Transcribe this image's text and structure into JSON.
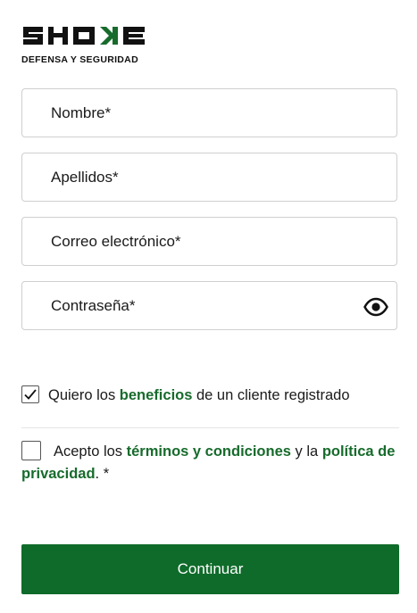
{
  "brand": {
    "logo_text": "SHOKE",
    "tagline": "DEFENSA Y SEGURIDAD",
    "logo_color": "#111111",
    "accent_color": "#176b2c"
  },
  "form": {
    "fields": [
      {
        "name": "nombre",
        "placeholder": "Nombre*",
        "value": ""
      },
      {
        "name": "apellidos",
        "placeholder": "Apellidos*",
        "value": ""
      },
      {
        "name": "correo",
        "placeholder": "Correo electrónico*",
        "value": ""
      },
      {
        "name": "contrasena",
        "placeholder": "Contraseña*",
        "value": "",
        "icon": "eye-icon"
      }
    ],
    "benefits": {
      "checked": true,
      "text_before": "Quiero los",
      "link": "beneficios",
      "text_after": "de un cliente registrado"
    },
    "terms": {
      "checked": false,
      "text_before": "Acepto los",
      "link_terms": "términos y condiciones",
      "text_middle": "y la",
      "link_privacy": "política de privacidad",
      "text_after": ". *"
    },
    "submit_label": "Continuar",
    "button_color": "#0f6b2a"
  }
}
